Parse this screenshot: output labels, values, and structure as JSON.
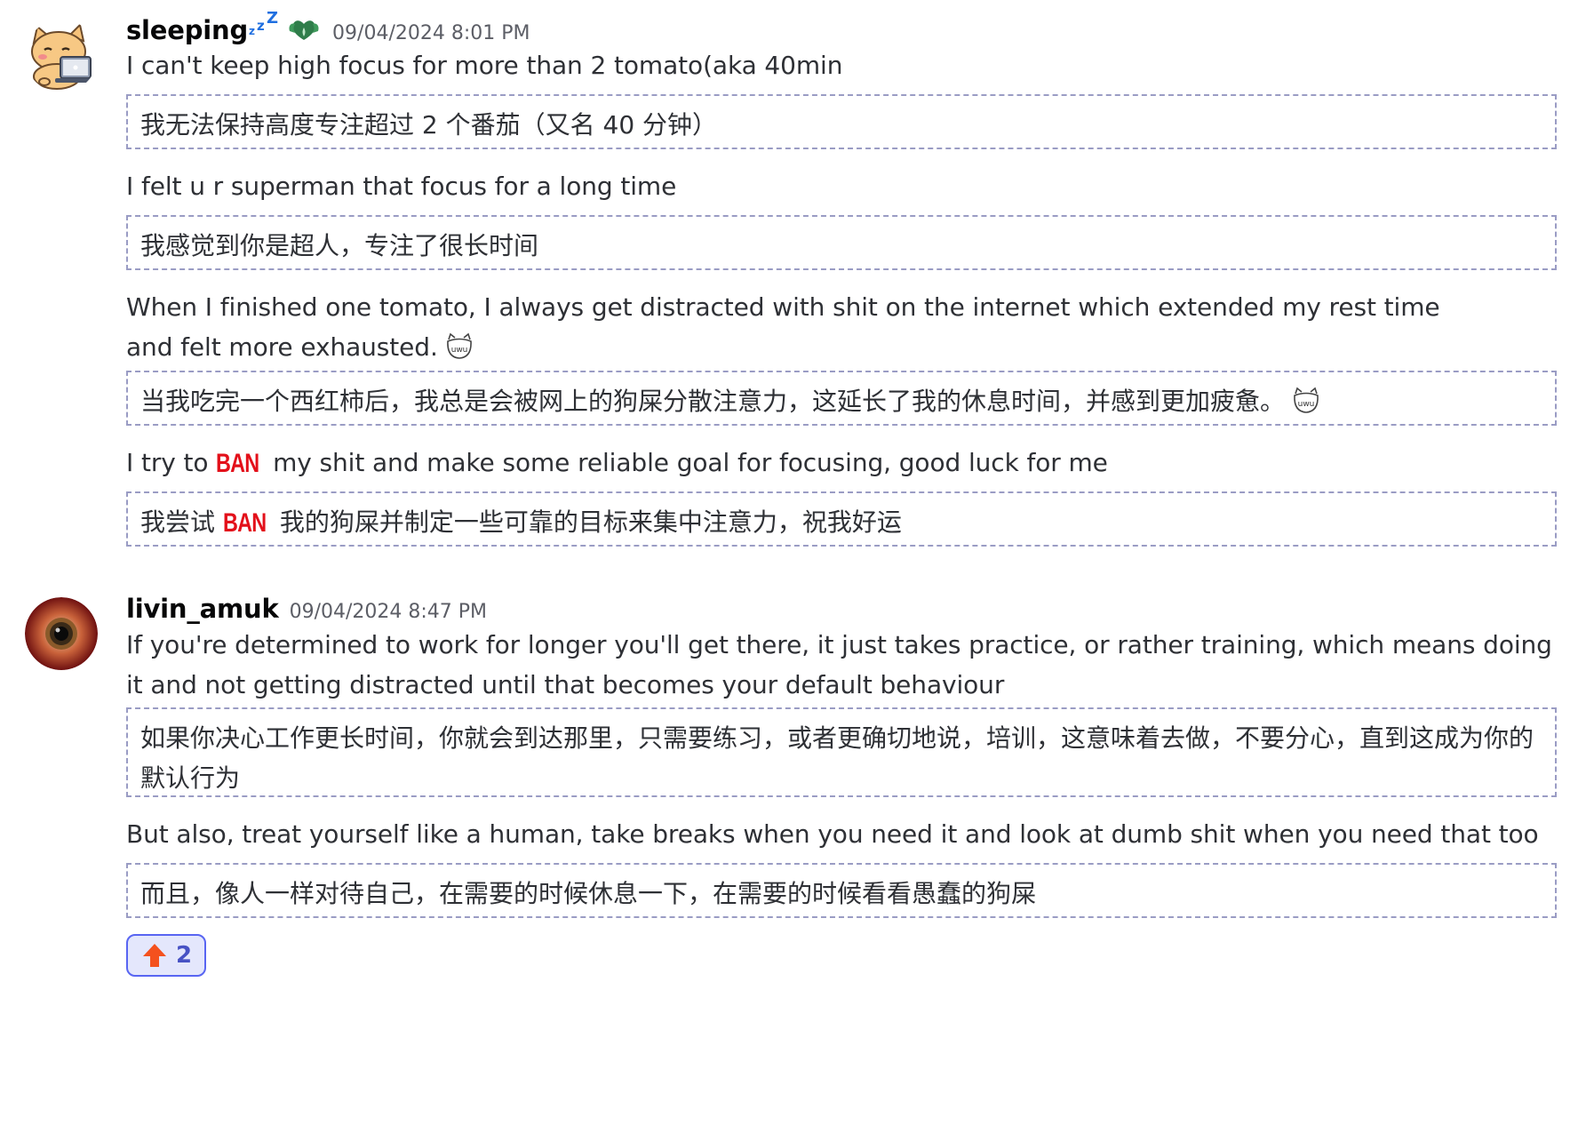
{
  "messages": [
    {
      "username": "sleeping",
      "timestamp": "09/04/2024 8:01 PM",
      "role_icon": "leaf-heart-icon",
      "avatar": "cat-with-laptop-avatar",
      "lines": [
        {
          "text": "I can't keep high focus for more than 2 tomato(aka 40min",
          "translation": "我无法保持高度专注超过 2 个番茄（又名 40 分钟）"
        },
        {
          "text": "I felt u r superman that focus for a long time",
          "translation": "我感觉到你是超人，专注了很长时间"
        },
        {
          "text": "When I finished one tomato, I always get distracted with shit on the internet which extended my rest time and felt more exhausted.",
          "translation": "当我吃完一个西红柿后，我总是会被网上的狗屎分散注意力，这延长了我的休息时间，并感到更加疲惫。",
          "emoji": "uwu-cat-emoji"
        },
        {
          "text_before": "I try to",
          "ban": "BAN",
          "text_after": "my shit and make some reliable goal for focusing, good luck for me",
          "translation_before": "我尝试",
          "translation_after": "我的狗屎并制定一些可靠的目标来集中注意力，祝我好运"
        }
      ]
    },
    {
      "username": "livin_amuk",
      "timestamp": "09/04/2024 8:47 PM",
      "avatar": "eyeball-avatar",
      "lines": [
        {
          "text": "If you're determined to work for longer you'll get there, it just takes practice, or rather training, which means doing it and not getting distracted until that becomes your default behaviour",
          "translation": "如果你决心工作更长时间，你就会到达那里，只需要练习，或者更确切地说，培训，这意味着去做，不要分心，直到这成为你的默认行为"
        },
        {
          "text": "But also, treat yourself like a human, take breaks when you need it and look at dumb shit when you need that too",
          "translation": "而且，像人一样对待自己，在需要的时候休息一下，在需要的时候看看愚蠢的狗屎"
        }
      ],
      "reaction": {
        "emoji": "up-arrow-icon",
        "count": "2"
      }
    }
  ],
  "colors": {
    "ban": "#e3101a",
    "reaction_border": "#5865f2",
    "translation_border": "#9a9cc4",
    "zzz": "#1f6fe0"
  }
}
